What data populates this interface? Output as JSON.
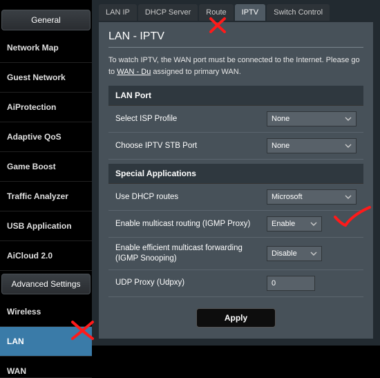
{
  "sidebar": {
    "sections": [
      {
        "header": "General",
        "items": [
          {
            "label": "Network Map"
          },
          {
            "label": "Guest Network"
          },
          {
            "label": "AiProtection"
          },
          {
            "label": "Adaptive QoS"
          },
          {
            "label": "Game Boost"
          },
          {
            "label": "Traffic Analyzer"
          },
          {
            "label": "USB Application"
          },
          {
            "label": "AiCloud 2.0"
          }
        ]
      },
      {
        "header": "Advanced Settings",
        "items": [
          {
            "label": "Wireless"
          },
          {
            "label": "LAN",
            "selected": true
          },
          {
            "label": "WAN"
          }
        ]
      }
    ]
  },
  "tabs": [
    {
      "label": "LAN IP"
    },
    {
      "label": "DHCP Server"
    },
    {
      "label": "Route"
    },
    {
      "label": "IPTV",
      "active": true
    },
    {
      "label": "Switch Control"
    }
  ],
  "panel": {
    "title": "LAN - IPTV",
    "desc_prefix": "To watch IPTV, the WAN port must be connected to the Internet. Please go to ",
    "desc_link": "WAN - Du",
    "desc_suffix": " assigned to primary WAN.",
    "section_lanport": "LAN Port",
    "row_isp_label": "Select ISP Profile",
    "row_isp_value": "None",
    "row_stb_label": "Choose IPTV STB Port",
    "row_stb_value": "None",
    "section_special": "Special Applications",
    "row_dhcp_label": "Use DHCP routes",
    "row_dhcp_value": "Microsoft",
    "row_igmp_label": "Enable multicast routing (IGMP Proxy)",
    "row_igmp_value": "Enable",
    "row_snoop_label": "Enable efficient multicast forwarding (IGMP Snooping)",
    "row_snoop_value": "Disable",
    "row_udpxy_label": "UDP Proxy (Udpxy)",
    "row_udpxy_value": "0",
    "apply": "Apply"
  }
}
